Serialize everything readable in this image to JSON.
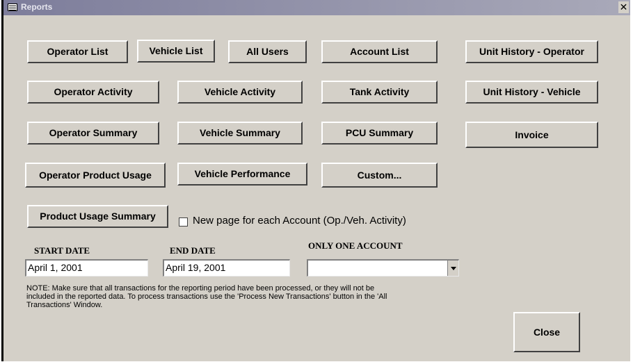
{
  "window": {
    "title": "Reports",
    "close_glyph": "✕"
  },
  "buttons": {
    "operator_list": "Operator List",
    "vehicle_list": "Vehicle List",
    "all_users": "All Users",
    "account_list": "Account List",
    "unit_history_operator": "Unit History - Operator",
    "operator_activity": "Operator Activity",
    "vehicle_activity": "Vehicle Activity",
    "tank_activity": "Tank Activity",
    "unit_history_vehicle": "Unit History - Vehicle",
    "operator_summary": "Operator Summary",
    "vehicle_summary": "Vehicle Summary",
    "pcu_summary": "PCU Summary",
    "invoice": "Invoice",
    "operator_product_usage": "Operator Product Usage",
    "vehicle_performance": "Vehicle Performance",
    "custom": "Custom...",
    "product_usage_summary": "Product Usage Summary",
    "close": "Close"
  },
  "new_page_option": {
    "label": "New page for each Account (Op./Veh. Activity)",
    "checked": false
  },
  "start_date": {
    "label": "START DATE",
    "value": "April 1, 2001"
  },
  "end_date": {
    "label": "END DATE",
    "value": "April 19, 2001"
  },
  "only_one_account": {
    "label": "ONLY ONE ACCOUNT",
    "value": ""
  },
  "note": "NOTE: Make sure that all transactions for the reporting period have been processed, or they will not be included in the reported data. To process transactions use the 'Process New Transactions' button in the 'All Transactions' Window."
}
